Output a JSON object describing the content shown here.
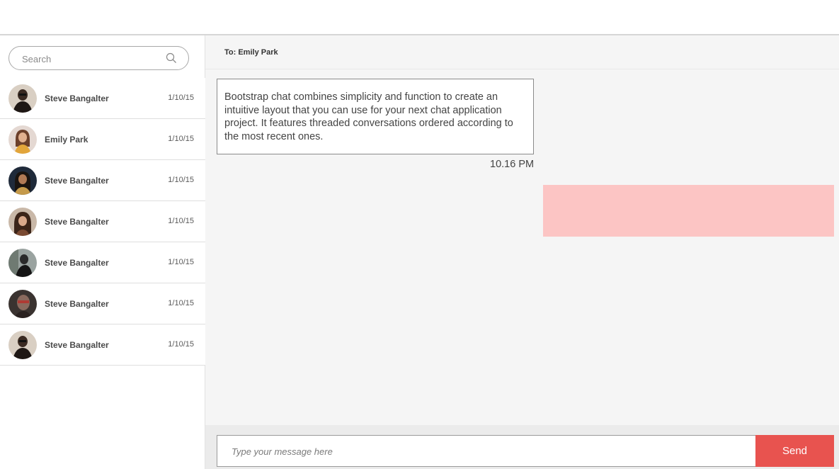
{
  "search": {
    "placeholder": "Search"
  },
  "contacts": [
    {
      "name": "Steve Bangalter",
      "date": "1/10/15",
      "avatar": "avatar-1"
    },
    {
      "name": "Emily Park",
      "date": "1/10/15",
      "avatar": "avatar-2"
    },
    {
      "name": "Steve Bangalter",
      "date": "1/10/15",
      "avatar": "avatar-3"
    },
    {
      "name": "Steve Bangalter",
      "date": "1/10/15",
      "avatar": "avatar-4"
    },
    {
      "name": "Steve Bangalter",
      "date": "1/10/15",
      "avatar": "avatar-5"
    },
    {
      "name": "Steve Bangalter",
      "date": "1/10/15",
      "avatar": "avatar-6"
    },
    {
      "name": "Steve Bangalter",
      "date": "1/10/15",
      "avatar": "avatar-7"
    }
  ],
  "conversation": {
    "to_label": "To: Emily Park",
    "incoming": {
      "text": "Bootstrap chat combines simplicity and function to create an intuitive layout that you can use for your next chat application project. It features threaded conversations ordered according to the most recent ones.",
      "time": "10.16 PM"
    },
    "outgoing": {
      "text": ""
    }
  },
  "composer": {
    "placeholder": "Type your message here",
    "send_label": "Send"
  },
  "colors": {
    "accent": "#e8534f",
    "outgoing_bubble": "#fcc5c4",
    "panel_bg": "#f5f5f5"
  },
  "icons": {
    "search": "search-icon"
  }
}
